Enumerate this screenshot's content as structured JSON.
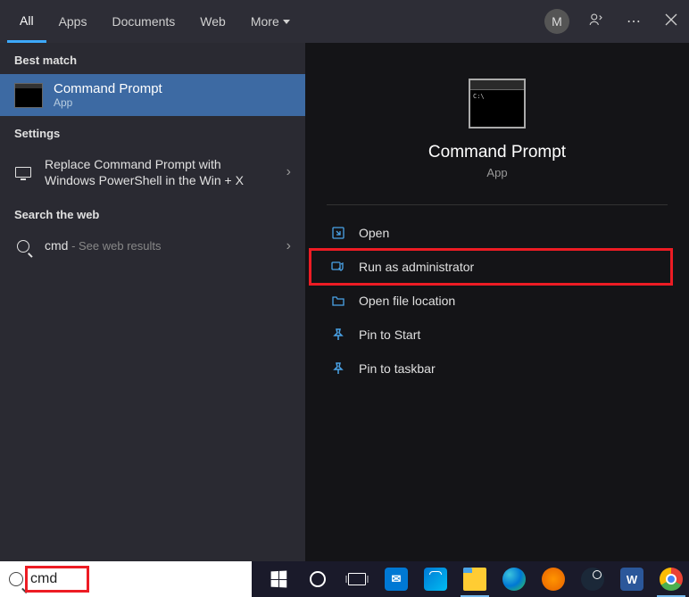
{
  "tabs": {
    "all": "All",
    "apps": "Apps",
    "documents": "Documents",
    "web": "Web",
    "more": "More"
  },
  "header": {
    "avatar_initial": "M"
  },
  "left": {
    "best_match_header": "Best match",
    "best_match": {
      "title": "Command Prompt",
      "subtitle": "App"
    },
    "settings_header": "Settings",
    "settings_item": "Replace Command Prompt with Windows PowerShell in the Win + X",
    "web_header": "Search the web",
    "web_item_prefix": "cmd",
    "web_item_suffix": " - See web results"
  },
  "right": {
    "title": "Command Prompt",
    "subtitle": "App",
    "actions": {
      "open": "Open",
      "run_admin": "Run as administrator",
      "open_location": "Open file location",
      "pin_start": "Pin to Start",
      "pin_taskbar": "Pin to taskbar"
    }
  },
  "search": {
    "value": "cmd"
  }
}
